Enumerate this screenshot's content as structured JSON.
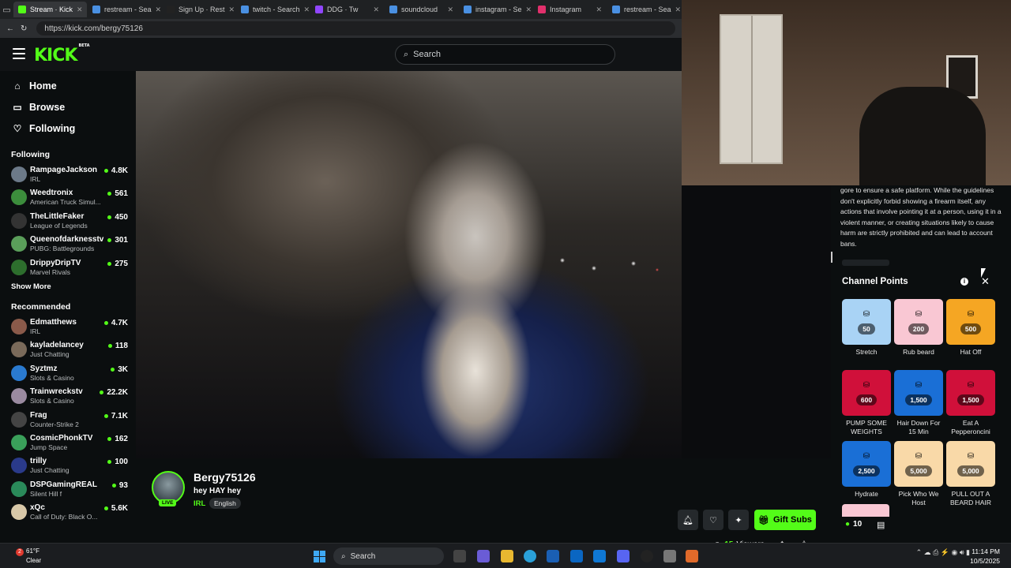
{
  "browser": {
    "tabs": [
      {
        "label": "Stream · Kick",
        "color": "#53fc18",
        "active": true
      },
      {
        "label": "restream - Sea",
        "color": "#4a90e2"
      },
      {
        "label": "Sign Up · Rest",
        "color": "#222222"
      },
      {
        "label": "twitch - Search",
        "color": "#4a90e2"
      },
      {
        "label": "DDG · Tw",
        "color": "#9146ff"
      },
      {
        "label": "soundcloud",
        "color": "#4a90e2"
      },
      {
        "label": "instagram - Se",
        "color": "#4a90e2"
      },
      {
        "label": "Instagram",
        "color": "#e1306c"
      },
      {
        "label": "restream - Sea",
        "color": "#4a90e2"
      }
    ],
    "url": "https://kick.com/bergy75126"
  },
  "kick": {
    "logo": "KICK",
    "logo_badge": "BETA",
    "search_placeholder": "Search",
    "nav": [
      {
        "label": "Home",
        "icon": "home-icon",
        "glyph": "⌂"
      },
      {
        "label": "Browse",
        "icon": "browse-icon",
        "glyph": "▭"
      },
      {
        "label": "Following",
        "icon": "heart-icon",
        "glyph": "♡"
      }
    ],
    "following_title": "Following",
    "following": [
      {
        "name": "RampageJackson",
        "category": "IRL",
        "viewers": "4.8K",
        "avatar": "#6c7a89"
      },
      {
        "name": "Weedtronix",
        "category": "American Truck Simul...",
        "viewers": "561",
        "avatar": "#3c8d3c"
      },
      {
        "name": "TheLittleFaker",
        "category": "League of Legends",
        "viewers": "450",
        "avatar": "#333333"
      },
      {
        "name": "Queenofdarknesstv",
        "category": "PUBG: Battlegrounds",
        "viewers": "301",
        "avatar": "#5a9e5a"
      },
      {
        "name": "DrippyDripTV",
        "category": "Marvel Rivals",
        "viewers": "275",
        "avatar": "#2d6e2d"
      }
    ],
    "show_more": "Show More",
    "recommended_title": "Recommended",
    "recommended": [
      {
        "name": "Edmatthews",
        "category": "IRL",
        "viewers": "4.7K",
        "avatar": "#8a5a4a"
      },
      {
        "name": "kayladelancey",
        "category": "Just Chatting",
        "viewers": "118",
        "avatar": "#7a6a5a"
      },
      {
        "name": "Syztmz",
        "category": "Slots & Casino",
        "viewers": "3K",
        "avatar": "#2a7ad0"
      },
      {
        "name": "Trainwreckstv",
        "category": "Slots & Casino",
        "viewers": "22.2K",
        "avatar": "#9a8aa0"
      },
      {
        "name": "Frag",
        "category": "Counter-Strike 2",
        "viewers": "7.1K",
        "avatar": "#444444"
      },
      {
        "name": "CosmicPhonkTV",
        "category": "Jump Space",
        "viewers": "162",
        "avatar": "#3aa05a"
      },
      {
        "name": "trilly",
        "category": "Just Chatting",
        "viewers": "100",
        "avatar": "#2a3a8a"
      },
      {
        "name": "DSPGamingREAL",
        "category": "Silent Hill f",
        "viewers": "93",
        "avatar": "#2a8a5a"
      },
      {
        "name": "xQc",
        "category": "Call of Duty: Black O...",
        "viewers": "5.6K",
        "avatar": "#d8c8a8"
      }
    ],
    "channel": {
      "name": "Bergy75126",
      "live": "LIVE",
      "title": "hey HAY hey",
      "category": "IRL",
      "language": "English",
      "gift_label": "Gift Subs",
      "viewers_count": "15",
      "viewers_label": "Viewers"
    },
    "chat": {
      "rules_text": "gore to ensure a safe platform. While the guidelines don't explicitly forbid showing a firearm itself, any actions that involve pointing it at a person, using it in a violent manner, or creating situations likely to cause harm are strictly prohibited and can lead to account bans.",
      "channel_points_title": "Channel Points",
      "rewards": [
        {
          "name": "Stretch",
          "cost": "50",
          "color": "#a9d3f5"
        },
        {
          "name": "Rub beard",
          "cost": "200",
          "color": "#f9c7d3"
        },
        {
          "name": "Hat Off",
          "cost": "500",
          "color": "#f5a623"
        },
        {
          "name": "PUMP SOME WEIGHTS",
          "cost": "600",
          "color": "#d0103a"
        },
        {
          "name": "Hair Down For 15 Min",
          "cost": "1,500",
          "color": "#1a6fd6"
        },
        {
          "name": "Eat A Pepperoncini",
          "cost": "1,500",
          "color": "#d0103a"
        },
        {
          "name": "Hydrate",
          "cost": "2,500",
          "color": "#1a6fd6"
        },
        {
          "name": "Pick Who We Host",
          "cost": "5,000",
          "color": "#f9d9a8"
        },
        {
          "name": "PULL OUT A BEARD HAIR",
          "cost": "5,000",
          "color": "#f9d9a8"
        }
      ],
      "points_balance": "10"
    }
  },
  "taskbar": {
    "temperature": "61°F",
    "condition": "Clear",
    "weather_badge": "2",
    "search_label": "Search",
    "time": "11:14 PM",
    "date": "10/5/2025"
  }
}
